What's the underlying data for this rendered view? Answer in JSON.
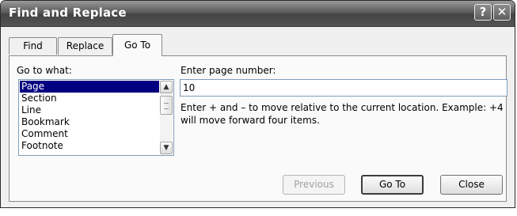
{
  "window": {
    "title": "Find and Replace",
    "help_glyph": "?",
    "close_glyph": "✕"
  },
  "tabs": [
    {
      "label": "Find"
    },
    {
      "label": "Replace"
    },
    {
      "label": "Go To"
    }
  ],
  "goto": {
    "label": "Go to what:",
    "items": [
      "Page",
      "Section",
      "Line",
      "Bookmark",
      "Comment",
      "Footnote"
    ],
    "selected": "Page"
  },
  "page_number": {
    "label": "Enter page number:",
    "value": "10",
    "hint": "Enter + and – to move relative to the current location. Example: +4 will move forward four items."
  },
  "buttons": {
    "previous": "Previous",
    "goto": "Go To",
    "close": "Close"
  }
}
